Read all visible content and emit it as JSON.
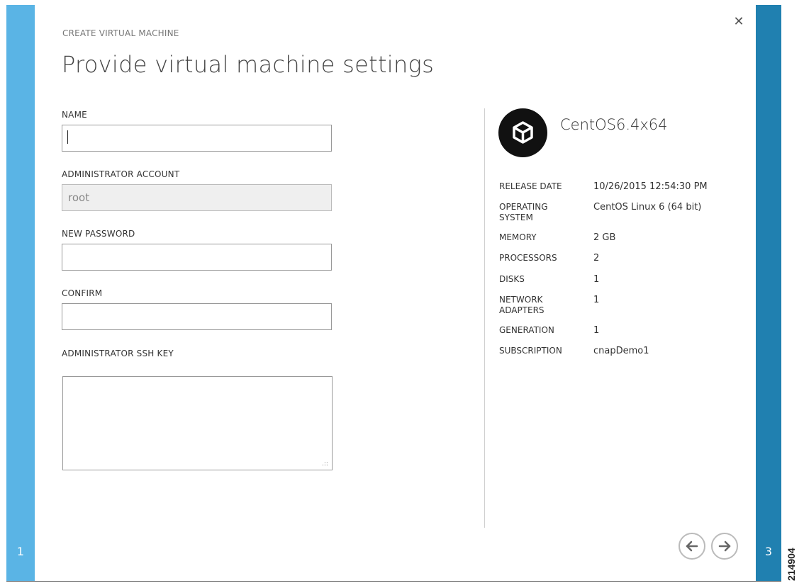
{
  "wizard": {
    "subtitle": "CREATE VIRTUAL MACHINE",
    "title": "Provide virtual machine settings",
    "left_step": "1",
    "right_step": "3"
  },
  "form": {
    "name_label": "NAME",
    "name_value": "",
    "admin_label": "ADMINISTRATOR ACCOUNT",
    "admin_value": "root",
    "password_label": "NEW PASSWORD",
    "password_value": "",
    "confirm_label": "CONFIRM",
    "confirm_value": "",
    "ssh_label": "ADMINISTRATOR SSH KEY",
    "ssh_value": ""
  },
  "details": {
    "os_name": "CentOS6.4x64",
    "rows": [
      {
        "key": "RELEASE DATE",
        "value": "10/26/2015 12:54:30 PM"
      },
      {
        "key": "OPERATING SYSTEM",
        "value": "CentOS Linux 6 (64 bit)"
      },
      {
        "key": "MEMORY",
        "value": "2 GB"
      },
      {
        "key": "PROCESSORS",
        "value": "2"
      },
      {
        "key": "DISKS",
        "value": "1"
      },
      {
        "key": "NETWORK ADAPTERS",
        "value": "1"
      },
      {
        "key": "GENERATION",
        "value": "1"
      },
      {
        "key": "SUBSCRIPTION",
        "value": "cnapDemo1"
      }
    ]
  },
  "icons": {
    "close": "close-icon",
    "os": "cube-icon",
    "back": "arrow-left-icon",
    "next": "arrow-right-icon"
  },
  "colors": {
    "left_rail": "#5ab4e5",
    "right_rail": "#2080b0"
  },
  "watermark": "214904"
}
